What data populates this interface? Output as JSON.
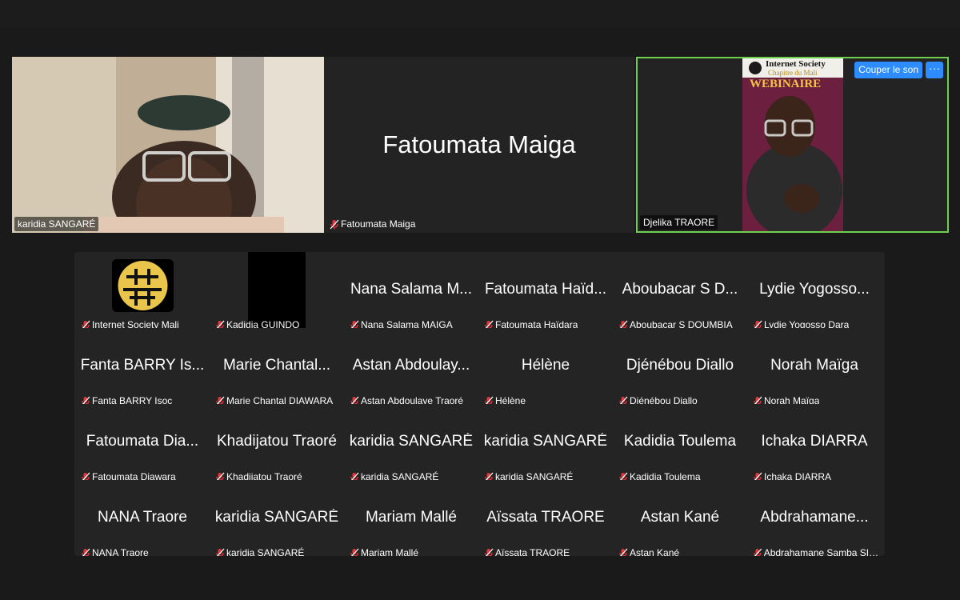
{
  "colors": {
    "active_speaker_border": "#6fcf4e",
    "accent_button": "#2d8cff",
    "mic_off_icon": "#e5343a"
  },
  "top_row": [
    {
      "name": "karidia SANGARÉ",
      "muted": false,
      "video": true
    },
    {
      "name": "Fatoumata Maiga",
      "big_name": "Fatoumata Maiga",
      "muted": true,
      "video": false
    },
    {
      "name": "Djelika TRAORE",
      "muted": false,
      "video": true,
      "active_speaker": true,
      "poster_text": {
        "line1": "Internet Society",
        "line2": "Chapitre du Mali",
        "line3": "WEBINAIRE"
      }
    }
  ],
  "controls": {
    "mute_label": "Couper le son",
    "more_label": "···"
  },
  "gallery": [
    {
      "display": "",
      "label": "Internet Society Mali",
      "icon": "isoc-logo"
    },
    {
      "display": "",
      "label": "Kadidia GUINDO",
      "icon": "black-video"
    },
    {
      "display": "Nana Salama M...",
      "label": "Nana Salama MAIGA"
    },
    {
      "display": "Fatoumata Haïd...",
      "label": "Fatoumata Haïdara"
    },
    {
      "display": "Aboubacar S D...",
      "label": "Aboubacar S DOUMBIA"
    },
    {
      "display": "Lydie Yogosso...",
      "label": "Lydie Yogosso Dara"
    },
    {
      "display": "Fanta BARRY Is...",
      "label": "Fanta BARRY Isoc"
    },
    {
      "display": "Marie Chantal...",
      "label": "Marie Chantal DIAWARA"
    },
    {
      "display": "Astan Abdoulay...",
      "label": "Astan Abdoulaye Traoré"
    },
    {
      "display": "Hélène",
      "label": "Hélène"
    },
    {
      "display": "Djénébou Diallo",
      "label": "Djénébou Diallo"
    },
    {
      "display": "Norah Maïga",
      "label": "Norah Maïga"
    },
    {
      "display": "Fatoumata Dia...",
      "label": "Fatoumata Diawara"
    },
    {
      "display": "Khadijatou Traoré",
      "label": "Khadijatou Traoré"
    },
    {
      "display": "karidia SANGARÉ",
      "label": "karidia SANGARÉ"
    },
    {
      "display": "karidia SANGARÉ",
      "label": "karidia SANGARÉ"
    },
    {
      "display": "Kadidia Toulema",
      "label": "Kadidia Toulema"
    },
    {
      "display": "Ichaka DIARRA",
      "label": "Ichaka DIARRA"
    },
    {
      "display": "NANA Traore",
      "label": "NANA Traore"
    },
    {
      "display": "karidia SANGARÉ",
      "label": "karidia SANGARÉ"
    },
    {
      "display": "Mariam Mallé",
      "label": "Mariam Mallé"
    },
    {
      "display": "Aïssata TRAORE",
      "label": "Aïssata TRAORE"
    },
    {
      "display": "Astan Kané",
      "label": "Astan Kané"
    },
    {
      "display": "Abdrahamane...",
      "label": "Abdrahamane Samba SID..."
    }
  ]
}
